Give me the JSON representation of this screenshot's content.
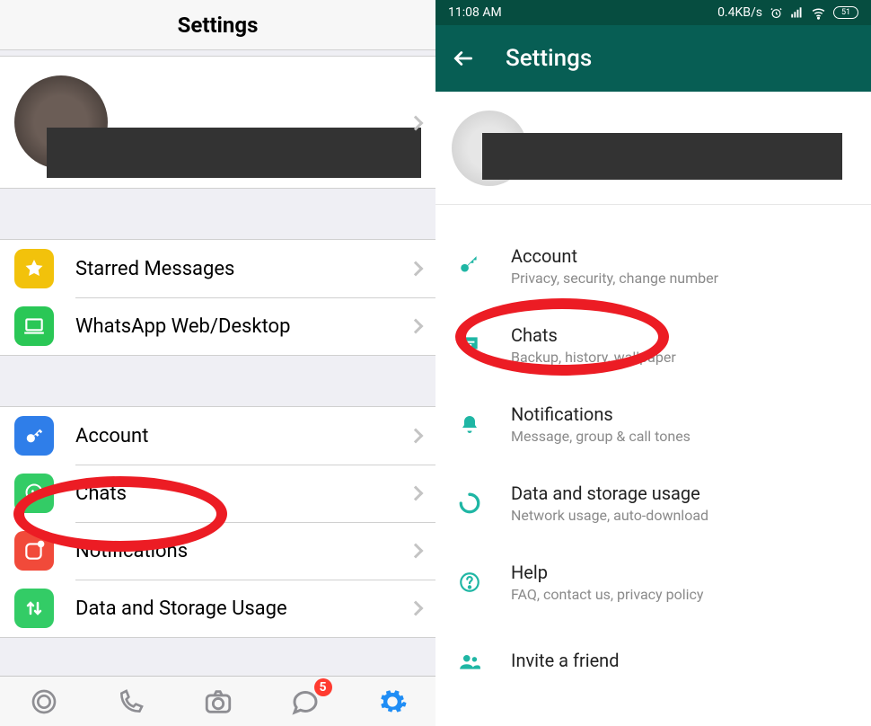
{
  "ios": {
    "header": {
      "title": "Settings"
    },
    "group1": [
      {
        "label": "Starred Messages"
      },
      {
        "label": "WhatsApp Web/Desktop"
      }
    ],
    "group2": [
      {
        "label": "Account"
      },
      {
        "label": "Chats"
      },
      {
        "label": "Notifications"
      },
      {
        "label": "Data and Storage Usage"
      }
    ],
    "tabbar": {
      "chat_badge": "5"
    }
  },
  "android": {
    "statusbar": {
      "time": "11:08 AM",
      "netspeed": "0.4KB/s",
      "battery": "51"
    },
    "appbar": {
      "title": "Settings"
    },
    "items": [
      {
        "title": "Account",
        "sub": "Privacy, security, change number"
      },
      {
        "title": "Chats",
        "sub": "Backup, history, wallpaper"
      },
      {
        "title": "Notifications",
        "sub": "Message, group & call tones"
      },
      {
        "title": "Data and storage usage",
        "sub": "Network usage, auto-download"
      },
      {
        "title": "Help",
        "sub": "FAQ, contact us, privacy policy"
      },
      {
        "title": "Invite a friend",
        "sub": ""
      }
    ]
  }
}
